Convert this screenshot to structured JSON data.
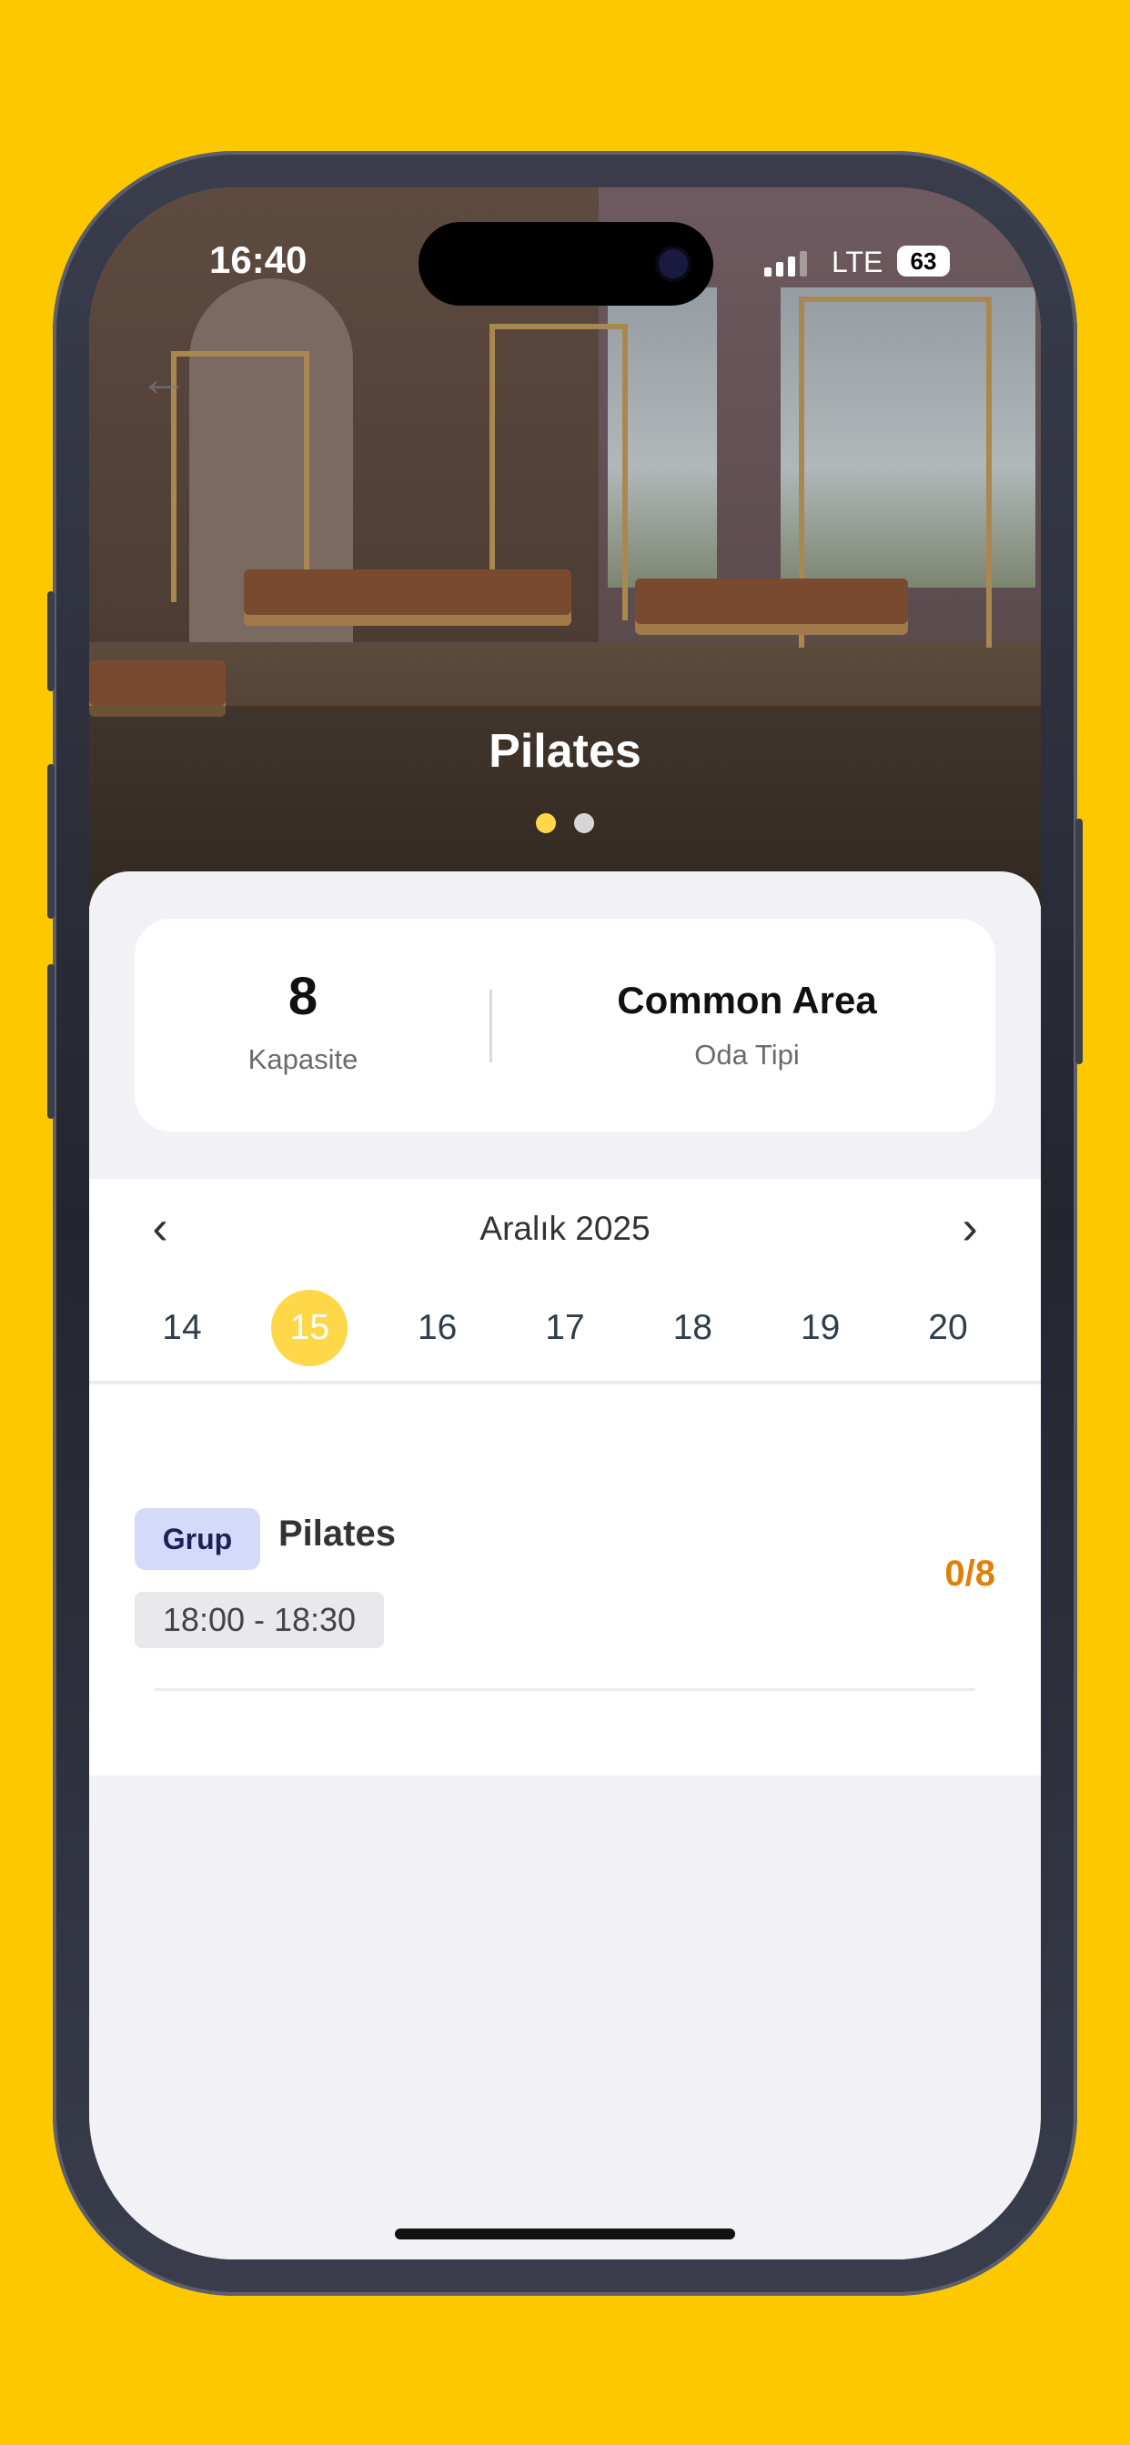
{
  "status_bar": {
    "time": "16:40",
    "network": "LTE",
    "battery": "63"
  },
  "hero": {
    "title": "Pilates",
    "pages": 2,
    "active_page": 1
  },
  "info": {
    "capacity_value": "8",
    "capacity_label": "Kapasite",
    "room_type_value": "Common Area",
    "room_type_label": "Oda Tipi"
  },
  "calendar": {
    "month_label": "Aralık 2025",
    "days": [
      "14",
      "15",
      "16",
      "17",
      "18",
      "19",
      "20"
    ],
    "selected_day": "15"
  },
  "sessions": [
    {
      "type_badge": "Grup",
      "name": "Pilates",
      "time": "18:00 - 18:30",
      "capacity": "0/8"
    }
  ],
  "colors": {
    "background": "#FDC800",
    "accent": "#FFD84A",
    "badge_bg": "#D5DAFA",
    "capacity": "#E0800A"
  }
}
